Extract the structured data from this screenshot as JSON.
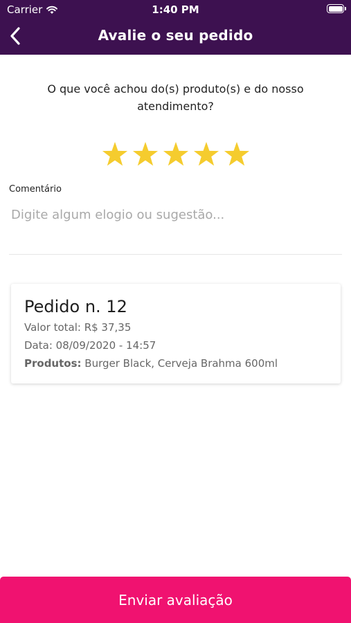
{
  "status_bar": {
    "carrier": "Carrier",
    "time": "1:40 PM",
    "wifi_icon": "wifi-icon",
    "battery_icon": "battery-icon"
  },
  "nav": {
    "title": "Avalie o seu pedido",
    "back_icon": "chevron-left-icon"
  },
  "review": {
    "question": "O que você achou do(s) produto(s) e do nosso atendimento?",
    "rating": 5,
    "max_rating": 5,
    "star_color": "#f5cc2e",
    "comment_label": "Comentário",
    "comment_value": "",
    "comment_placeholder": "Digite algum elogio ou sugestão..."
  },
  "order": {
    "title": "Pedido n. 12",
    "total_label": "Valor total:",
    "total_value": "R$ 37,35",
    "date_label": "Data:",
    "date_value": "08/09/2020 - 14:57",
    "products_label": "Produtos:",
    "products_value": "Burger Black, Cerveja Brahma 600ml"
  },
  "submit": {
    "label": "Enviar avaliação"
  },
  "colors": {
    "header": "#3d1150",
    "accent": "#f01270",
    "star": "#f5cc2e"
  }
}
